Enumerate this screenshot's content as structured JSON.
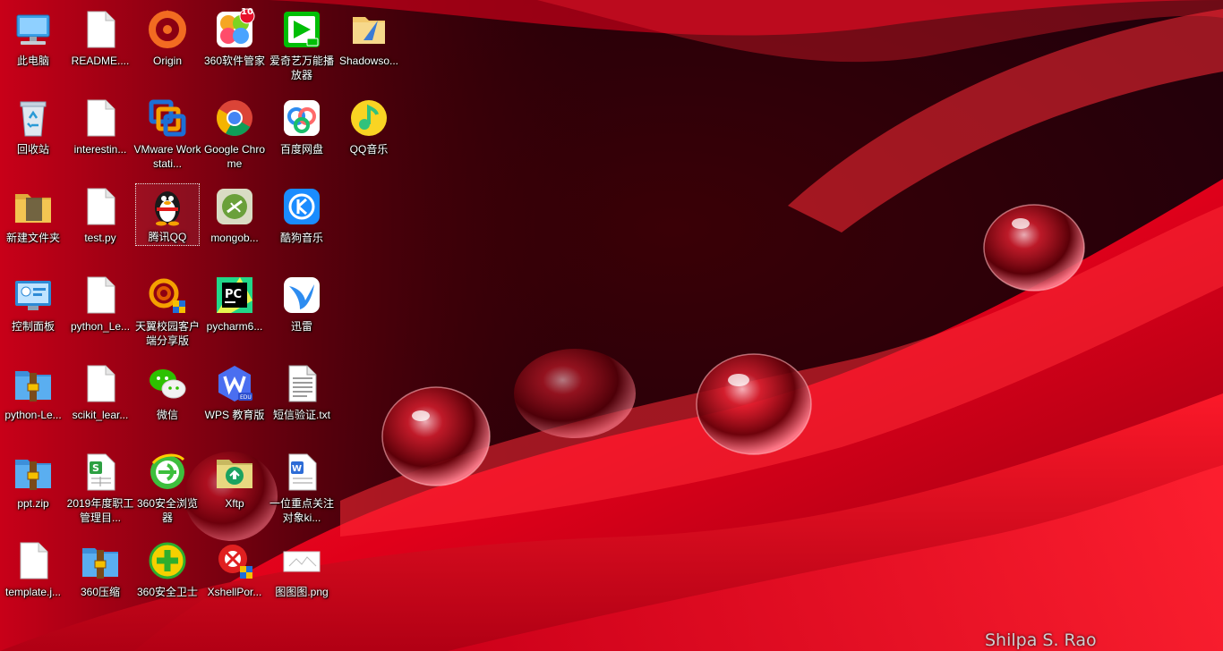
{
  "desktop": {
    "icons": [
      {
        "label": "此电脑",
        "icon": "computer-icon"
      },
      {
        "label": "README....",
        "icon": "file-icon"
      },
      {
        "label": "Origin",
        "icon": "origin-icon"
      },
      {
        "label": "360软件管家",
        "icon": "360-software-manager-icon",
        "badge": "10"
      },
      {
        "label": "爱奇艺万能播放器",
        "icon": "iqiyi-player-icon"
      },
      {
        "label": "Shadowso...",
        "icon": "shadowsocks-icon"
      },
      {
        "label": "回收站",
        "icon": "recycle-bin-icon"
      },
      {
        "label": "interestin...",
        "icon": "file-icon"
      },
      {
        "label": "VMware Workstati...",
        "icon": "vmware-icon"
      },
      {
        "label": "Google Chrome",
        "icon": "chrome-icon"
      },
      {
        "label": "百度网盘",
        "icon": "baidu-netdisk-icon"
      },
      {
        "label": "QQ音乐",
        "icon": "qq-music-icon"
      },
      {
        "label": "新建文件夹",
        "icon": "folder-icon"
      },
      {
        "label": "test.py",
        "icon": "file-icon"
      },
      {
        "label": "腾讯QQ",
        "icon": "qq-penguin-icon"
      },
      {
        "label": "mongob...",
        "icon": "mongobooster-icon"
      },
      {
        "label": "酷狗音乐",
        "icon": "kugou-icon"
      },
      {
        "label": "控制面板",
        "icon": "control-panel-icon"
      },
      {
        "label": "python_Le...",
        "icon": "file-icon"
      },
      {
        "label": "天翼校园客户端分享版",
        "icon": "tianyi-client-icon"
      },
      {
        "label": "pycharm6...",
        "icon": "pycharm-icon"
      },
      {
        "label": "迅雷",
        "icon": "xunlei-icon"
      },
      {
        "label": "python-Le...",
        "icon": "archive-icon"
      },
      {
        "label": "scikit_lear...",
        "icon": "file-icon"
      },
      {
        "label": "微信",
        "icon": "wechat-icon"
      },
      {
        "label": "WPS 教育版",
        "icon": "wps-edu-icon"
      },
      {
        "label": "短信验证.txt",
        "icon": "text-file-icon"
      },
      {
        "label": "ppt.zip",
        "icon": "archive-icon"
      },
      {
        "label": "2019年度职工管理目...",
        "icon": "spreadsheet-icon"
      },
      {
        "label": "360安全浏览器",
        "icon": "360-browser-icon"
      },
      {
        "label": "Xftp",
        "icon": "xftp-icon"
      },
      {
        "label": "一位重点关注对象ki...",
        "icon": "word-doc-icon"
      },
      {
        "label": "template.j...",
        "icon": "file-icon"
      },
      {
        "label": "360压缩",
        "icon": "archive-icon"
      },
      {
        "label": "360安全卫士",
        "icon": "360-security-icon"
      },
      {
        "label": "XshellPor...",
        "icon": "xshell-icon"
      },
      {
        "label": "图图图.png",
        "icon": "image-file-icon"
      }
    ],
    "selected_label": "腾讯QQ"
  },
  "wallpaper": {
    "credit": "Shilpa S. Rao",
    "colors": {
      "petal": "#e3001a",
      "dark": "#2a0004",
      "highlight": "#ff3340"
    }
  }
}
